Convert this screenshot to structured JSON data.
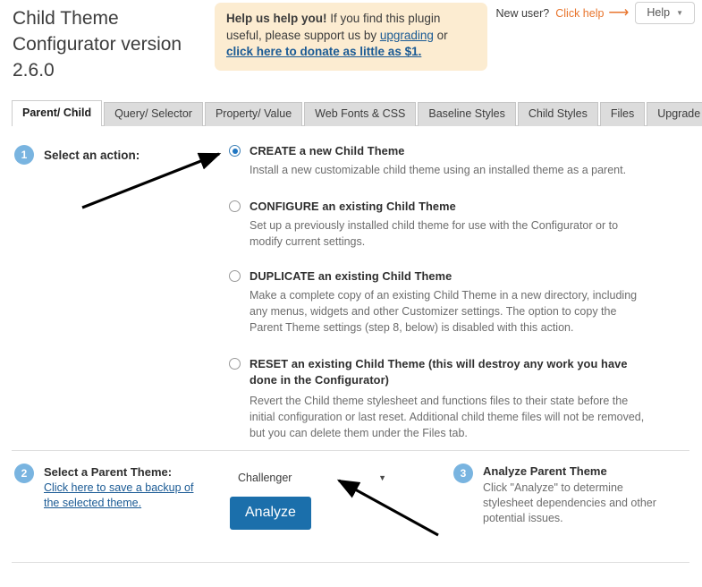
{
  "header": {
    "title": "Child Theme Configurator version 2.6.0",
    "notice": {
      "strong": "Help us help you!",
      "text_1": " If you find this plugin useful, please support us by ",
      "link_upgrading": "upgrading",
      "text_2": " or ",
      "link_donate": "click here to donate as little as $1."
    },
    "new_user_label": "New user?",
    "new_user_link": "Click help",
    "new_user_arrow_icon": "arrow-right-icon",
    "help_button_label": "Help",
    "help_caret_icon": "chevron-down-icon",
    "accent_orange": "#e8742c",
    "link_blue": "#1a5a94"
  },
  "tabs": [
    {
      "label": "Parent/ Child",
      "active": true
    },
    {
      "label": "Query/ Selector",
      "active": false
    },
    {
      "label": "Property/ Value",
      "active": false
    },
    {
      "label": "Web Fonts & CSS",
      "active": false
    },
    {
      "label": "Baseline Styles",
      "active": false
    },
    {
      "label": "Child Styles",
      "active": false
    },
    {
      "label": "Files",
      "active": false
    },
    {
      "label": "Upgrade",
      "active": false
    }
  ],
  "step1": {
    "number": "1",
    "label": "Select an action:",
    "options": [
      {
        "title": "CREATE a new Child Theme",
        "desc": "Install a new customizable child theme using an installed theme as a parent.",
        "selected": true
      },
      {
        "title": "CONFIGURE an existing Child Theme",
        "desc": "Set up a previously installed child theme for use with the Configurator or to modify current settings.",
        "selected": false
      },
      {
        "title": "DUPLICATE an existing Child Theme",
        "desc": "Make a complete copy of an existing Child Theme in a new directory, including any menus, widgets and other Customizer settings. The option to copy the Parent Theme settings (step 8, below) is disabled with this action.",
        "selected": false
      },
      {
        "title": "RESET an existing Child Theme (this will destroy any work you have done in the Configurator)",
        "desc": "Revert the Child theme stylesheet and functions files to their state before the initial configuration or last reset. Additional child theme files will not be removed, but you can delete them under the Files tab.",
        "selected": false
      }
    ]
  },
  "step2": {
    "number": "2",
    "title": "Select a Parent Theme:",
    "backup_link": "Click here to save a backup of the selected theme.",
    "theme_selected": "Challenger",
    "theme_caret_icon": "chevron-down-icon",
    "analyze_button": "Analyze",
    "analyze_button_color": "#1b6fab"
  },
  "step3": {
    "number": "3",
    "title": "Analyze Parent Theme",
    "desc": "Click \"Analyze\" to determine stylesheet dependencies and other potential issues."
  },
  "annotations": {
    "arrow_1_target": "create-radio",
    "arrow_2_target": "theme-select-dropdown"
  }
}
